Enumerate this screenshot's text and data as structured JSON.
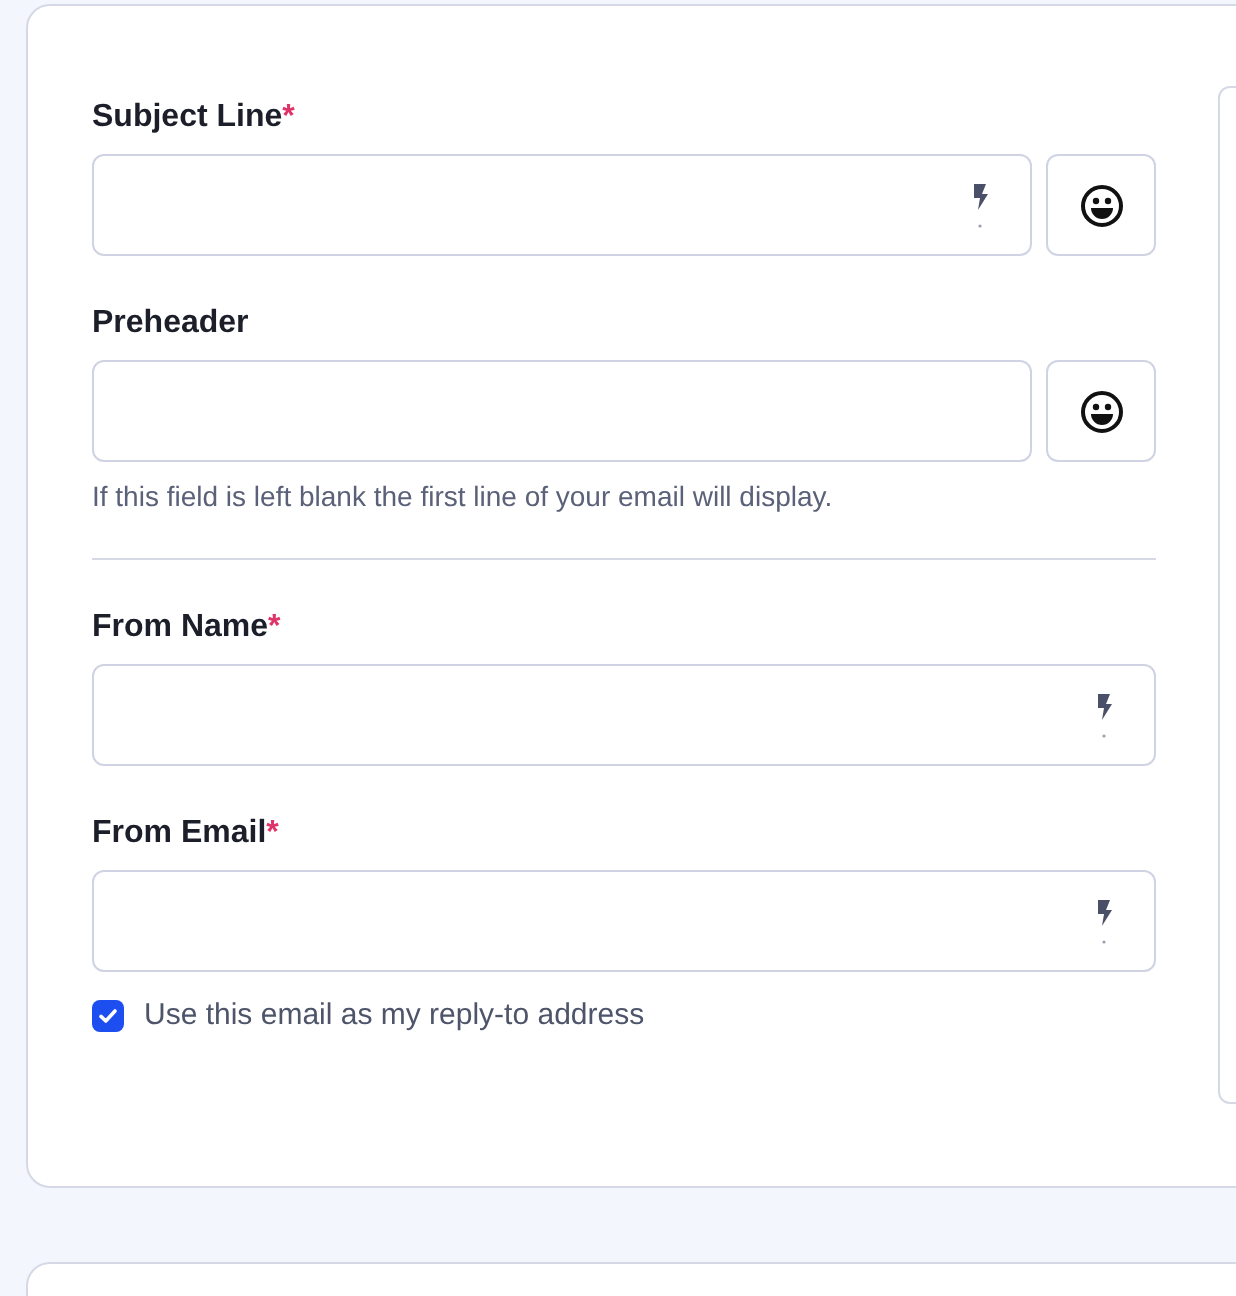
{
  "fields": [
    {
      "kind": "emoji_input",
      "label": "Subject Line",
      "required_mark": "*",
      "merge_tags": true
    },
    {
      "kind": "emoji_input",
      "label": "Preheader",
      "merge_tags": false,
      "hint": "If this field is left blank the first line of your email will display."
    },
    {
      "kind": "divider"
    },
    {
      "kind": "input",
      "label": "From Name",
      "required_mark": "*",
      "merge_tags": true
    },
    {
      "kind": "input",
      "label": "From Email",
      "required_mark": "*",
      "merge_tags": true
    }
  ],
  "reply_to": {
    "label": "Use this email as my reply-to address",
    "checked": true
  }
}
